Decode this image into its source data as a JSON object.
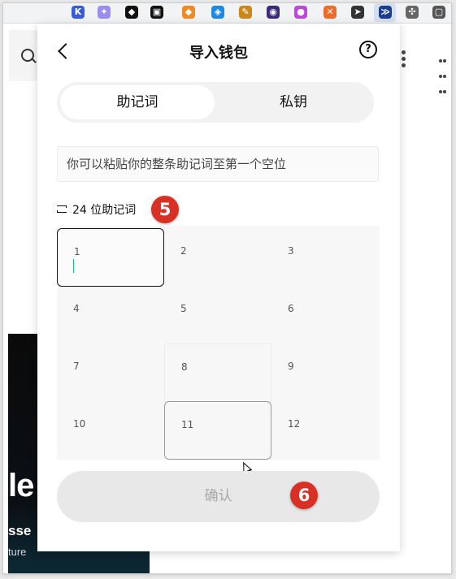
{
  "browser": {
    "extensions": [
      {
        "name": "k-ext-icon",
        "glyph": "K",
        "color": "#3a5bd9"
      },
      {
        "name": "feather-ext-icon",
        "glyph": "✦",
        "color": "#9a8cf0"
      },
      {
        "name": "chat-ext-icon",
        "glyph": "◆",
        "color": "#111111"
      },
      {
        "name": "hatch-ext-icon",
        "glyph": "▣",
        "color": "#111111"
      },
      {
        "name": "fox-ext-icon",
        "glyph": "◆",
        "color": "#f08a24"
      },
      {
        "name": "shield-ext-icon",
        "glyph": "◈",
        "color": "#1e88e5"
      },
      {
        "name": "pencil-ext-icon",
        "glyph": "✎",
        "color": "#c8891a"
      },
      {
        "name": "globe-ext-icon",
        "glyph": "◉",
        "color": "#3b2a7a"
      },
      {
        "name": "bot-ext-icon",
        "glyph": "●",
        "color": "#b84ad6"
      },
      {
        "name": "x-ext-icon",
        "glyph": "✕",
        "color": "#f06a2a"
      },
      {
        "name": "send-ext-icon",
        "glyph": "➤",
        "color": "#333333"
      },
      {
        "name": "active-ext-icon",
        "glyph": "≫",
        "color": "#1a3d8f"
      },
      {
        "name": "puzzle-ext-icon",
        "glyph": "✣",
        "color": "#666666"
      },
      {
        "name": "window-ext-icon",
        "glyph": "▢",
        "color": "#555555"
      }
    ]
  },
  "background": {
    "headline_fragment": "le",
    "subline_fragment": "sse",
    "caption_fragment": "ture"
  },
  "popup": {
    "title": "导入钱包",
    "help_glyph": "?",
    "tabs": [
      {
        "label": "助记词",
        "active": true
      },
      {
        "label": "私钥",
        "active": false
      }
    ],
    "paste_hint": "你可以粘贴你的整条助记词至第一个空位",
    "word_count_label": "24 位助记词",
    "word_slots": [
      "1",
      "2",
      "3",
      "4",
      "5",
      "6",
      "7",
      "8",
      "9",
      "10",
      "11",
      "12"
    ],
    "confirm_label": "确认"
  },
  "annotations": {
    "step_a": "5",
    "step_b": "6",
    "badge_color": "#d93025"
  }
}
